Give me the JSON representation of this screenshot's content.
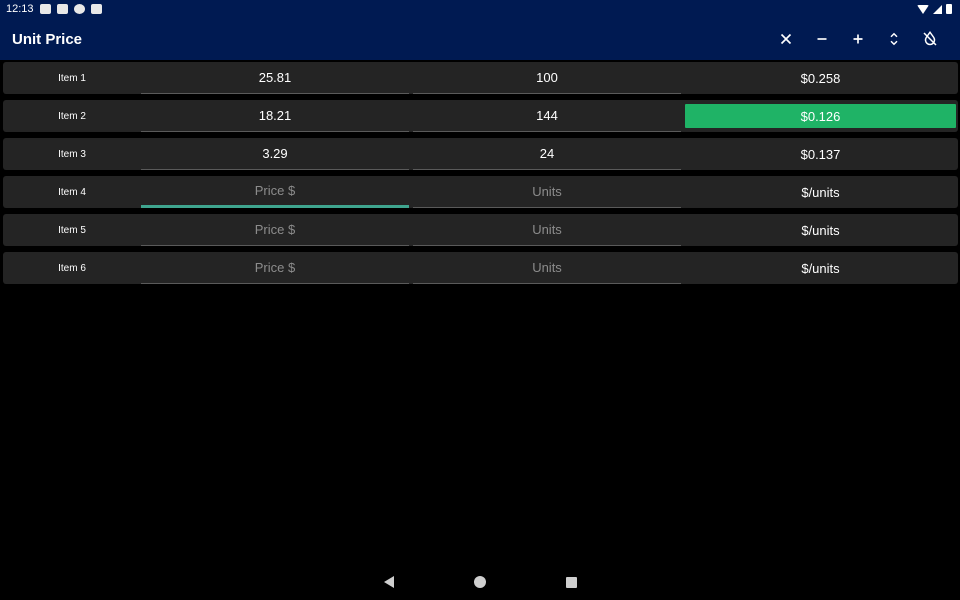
{
  "status_bar": {
    "time": "12:13"
  },
  "app_bar": {
    "title": "Unit Price",
    "actions": [
      {
        "name": "clear",
        "icon": "close-icon"
      },
      {
        "name": "remove-row",
        "icon": "minus-icon"
      },
      {
        "name": "add-row",
        "icon": "plus-icon"
      },
      {
        "name": "sort",
        "icon": "unfold-icon"
      },
      {
        "name": "theme",
        "icon": "invert-colors-off-icon"
      }
    ]
  },
  "rows": [
    {
      "label": "Item 1",
      "price": "25.81",
      "units": "100",
      "result": "$0.258",
      "best": false
    },
    {
      "label": "Item 2",
      "price": "18.21",
      "units": "144",
      "result": "$0.126",
      "best": true
    },
    {
      "label": "Item 3",
      "price": "3.29",
      "units": "24",
      "result": "$0.137",
      "best": false
    },
    {
      "label": "Item 4",
      "price": "",
      "units": "",
      "result": "$/units",
      "best": false
    },
    {
      "label": "Item 5",
      "price": "",
      "units": "",
      "result": "$/units",
      "best": false
    },
    {
      "label": "Item 6",
      "price": "",
      "units": "",
      "result": "$/units",
      "best": false
    }
  ],
  "placeholders": {
    "price": "Price $",
    "units": "Units"
  },
  "colors": {
    "app_bar": "#001a52",
    "row_bg": "#242424",
    "best_highlight": "#1fb366",
    "focus_underline": "#3fa58f"
  }
}
